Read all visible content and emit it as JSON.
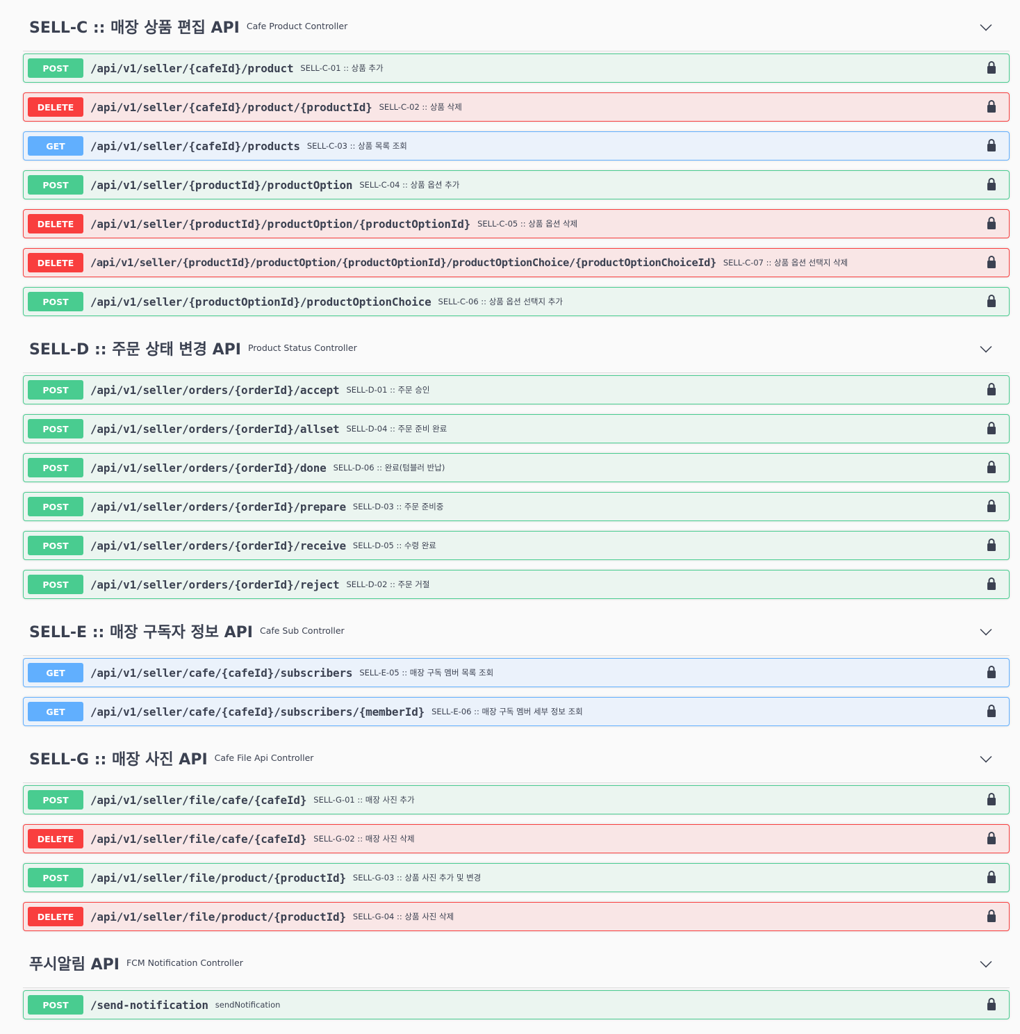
{
  "sections": [
    {
      "title": "SELL-C :: 매장 상품 편집 API",
      "description": "Cafe Product Controller",
      "operations": [
        {
          "method": "POST",
          "path": "/api/v1/seller/{cafeId}/product",
          "summary": "SELL-C-01 :: 상품 추가"
        },
        {
          "method": "DELETE",
          "path": "/api/v1/seller/{cafeId}/product/{productId}",
          "summary": "SELL-C-02 :: 상품 삭제"
        },
        {
          "method": "GET",
          "path": "/api/v1/seller/{cafeId}/products",
          "summary": "SELL-C-03 :: 상품 목록 조회"
        },
        {
          "method": "POST",
          "path": "/api/v1/seller/{productId}/productOption",
          "summary": "SELL-C-04 :: 상품 옵션 추가"
        },
        {
          "method": "DELETE",
          "path": "/api/v1/seller/{productId}/productOption/{productOptionId}",
          "summary": "SELL-C-05 :: 상품 옵션 삭제"
        },
        {
          "method": "DELETE",
          "path": "/api/v1/seller/{productId}/productOption/{productOptionId}/productOptionChoice/{productOptionChoiceId}",
          "summary": "SELL-C-07 :: 상품 옵션 선택지 삭제"
        },
        {
          "method": "POST",
          "path": "/api/v1/seller/{productOptionId}/productOptionChoice",
          "summary": "SELL-C-06 :: 상품 옵션 선택지 추가"
        }
      ]
    },
    {
      "title": "SELL-D :: 주문 상태 변경 API",
      "description": "Product Status Controller",
      "operations": [
        {
          "method": "POST",
          "path": "/api/v1/seller/orders/{orderId}/accept",
          "summary": "SELL-D-01 :: 주문 승인"
        },
        {
          "method": "POST",
          "path": "/api/v1/seller/orders/{orderId}/allset",
          "summary": "SELL-D-04 :: 주문 준비 완료"
        },
        {
          "method": "POST",
          "path": "/api/v1/seller/orders/{orderId}/done",
          "summary": "SELL-D-06 :: 완료(텀블러 반납)"
        },
        {
          "method": "POST",
          "path": "/api/v1/seller/orders/{orderId}/prepare",
          "summary": "SELL-D-03 :: 주문 준비중"
        },
        {
          "method": "POST",
          "path": "/api/v1/seller/orders/{orderId}/receive",
          "summary": "SELL-D-05 :: 수령 완료"
        },
        {
          "method": "POST",
          "path": "/api/v1/seller/orders/{orderId}/reject",
          "summary": "SELL-D-02 :: 주문 거절"
        }
      ]
    },
    {
      "title": "SELL-E :: 매장 구독자 정보 API",
      "description": "Cafe Sub Controller",
      "operations": [
        {
          "method": "GET",
          "path": "/api/v1/seller/cafe/{cafeId}/subscribers",
          "summary": "SELL-E-05 :: 매장 구독 멤버 목록 조회"
        },
        {
          "method": "GET",
          "path": "/api/v1/seller/cafe/{cafeId}/subscribers/{memberId}",
          "summary": "SELL-E-06 :: 매장 구독 멤버 세부 정보 조회"
        }
      ]
    },
    {
      "title": "SELL-G :: 매장 사진 API",
      "description": "Cafe File Api Controller",
      "operations": [
        {
          "method": "POST",
          "path": "/api/v1/seller/file/cafe/{cafeId}",
          "summary": "SELL-G-01 :: 매장 사진 추가"
        },
        {
          "method": "DELETE",
          "path": "/api/v1/seller/file/cafe/{cafeId}",
          "summary": "SELL-G-02 :: 매장 사진 삭제"
        },
        {
          "method": "POST",
          "path": "/api/v1/seller/file/product/{productId}",
          "summary": "SELL-G-03 :: 상품 사진 추가 및 변경"
        },
        {
          "method": "DELETE",
          "path": "/api/v1/seller/file/product/{productId}",
          "summary": "SELL-G-04 :: 상품 사진 삭제"
        }
      ]
    },
    {
      "title": "푸시알림 API",
      "description": "FCM Notification Controller",
      "operations": [
        {
          "method": "POST",
          "path": "/send-notification",
          "summary": "sendNotification"
        }
      ]
    }
  ],
  "icons": {
    "lock": "lock-icon",
    "expand": "chevron-down-icon"
  },
  "colors": {
    "post": "#49cc90",
    "delete": "#f93e3e",
    "get": "#61affe",
    "text": "#3b4151"
  }
}
